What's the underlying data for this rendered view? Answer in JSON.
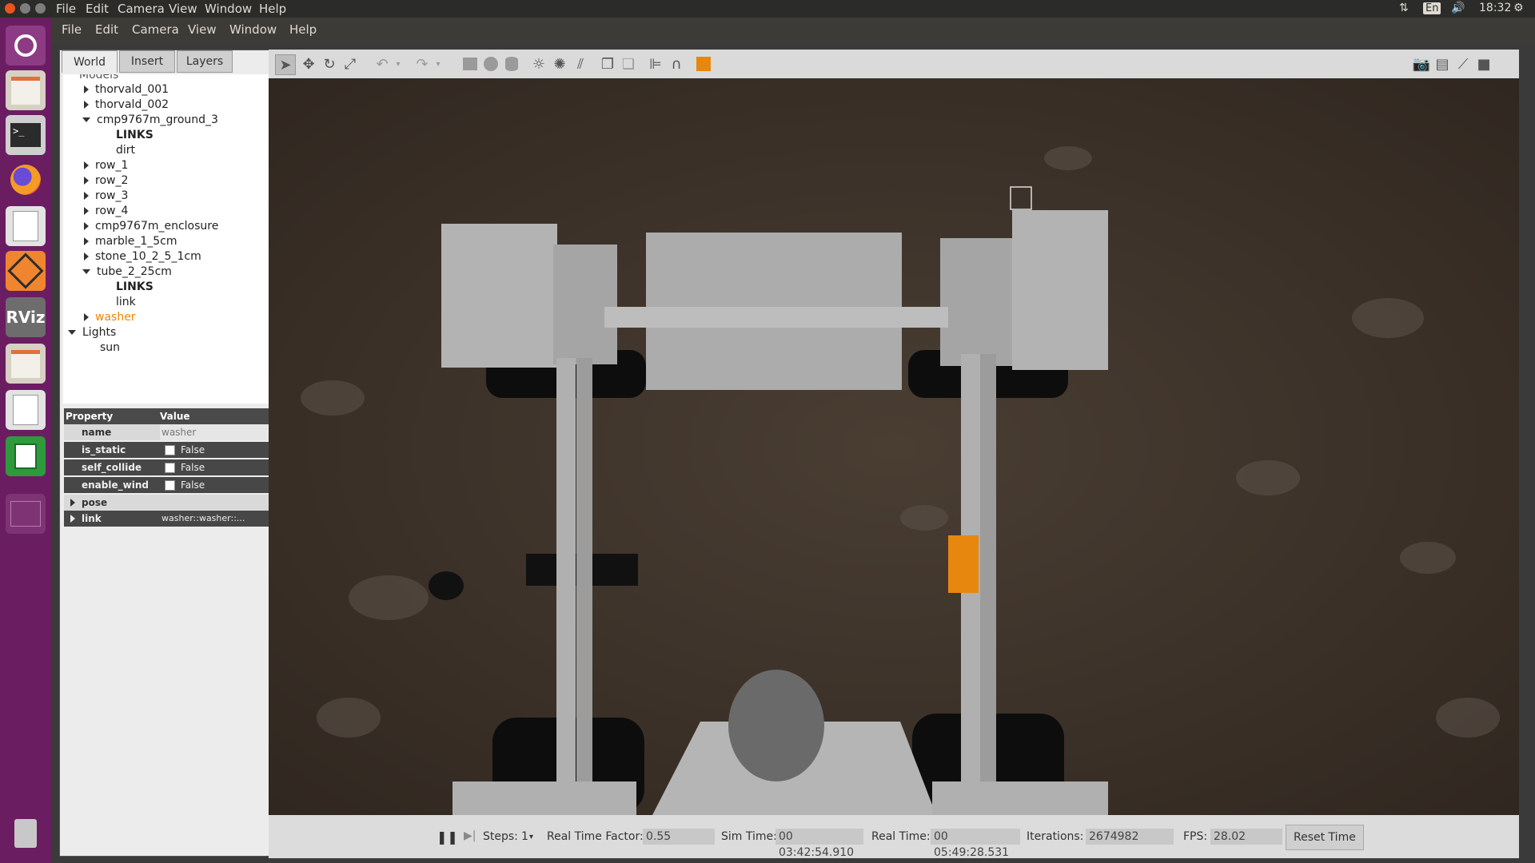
{
  "system_bar": {
    "menus": [
      "File",
      "Edit",
      "Camera",
      "View",
      "Window",
      "Help"
    ],
    "clock": "18:32",
    "keyboard": "En",
    "icons": [
      "network-icon",
      "keyboard-icon",
      "volume-icon",
      "settings-gear-icon"
    ]
  },
  "launcher": {
    "items": [
      {
        "name": "ubuntu-dash-icon"
      },
      {
        "name": "file-manager-icon"
      },
      {
        "name": "terminal-icon"
      },
      {
        "name": "firefox-icon"
      },
      {
        "name": "text-editor-icon"
      },
      {
        "name": "gazebo-icon"
      },
      {
        "name": "rviz-icon",
        "label": "RViz"
      },
      {
        "name": "file-manager-icon-2"
      },
      {
        "name": "text-editor-icon-2"
      },
      {
        "name": "spreadsheet-icon"
      },
      {
        "name": "workspace-switcher-icon"
      },
      {
        "name": "trash-icon"
      }
    ]
  },
  "app_menu": [
    "File",
    "Edit",
    "Camera",
    "View",
    "Window",
    "Help"
  ],
  "left_panel": {
    "tabs": [
      "World",
      "Insert",
      "Layers"
    ],
    "active_tab": "World",
    "tree": {
      "cut_header": "Models",
      "items": [
        {
          "label": "thorvald_001",
          "expanded": false,
          "level": 1
        },
        {
          "label": "thorvald_002",
          "expanded": false,
          "level": 1
        },
        {
          "label": "cmp9767m_ground_3",
          "expanded": true,
          "level": 1
        },
        {
          "label": "LINKS",
          "level": 2,
          "bold": true
        },
        {
          "label": "dirt",
          "level": 2
        },
        {
          "label": "row_1",
          "expanded": false,
          "level": 1
        },
        {
          "label": "row_2",
          "expanded": false,
          "level": 1
        },
        {
          "label": "row_3",
          "expanded": false,
          "level": 1
        },
        {
          "label": "row_4",
          "expanded": false,
          "level": 1
        },
        {
          "label": "cmp9767m_enclosure",
          "expanded": false,
          "level": 1
        },
        {
          "label": "marble_1_5cm",
          "expanded": false,
          "level": 1
        },
        {
          "label": "stone_10_2_5_1cm",
          "expanded": false,
          "level": 1
        },
        {
          "label": "tube_2_25cm",
          "expanded": true,
          "level": 1
        },
        {
          "label": "LINKS",
          "level": 2,
          "bold": true
        },
        {
          "label": "link",
          "level": 2
        },
        {
          "label": "washer",
          "expanded": false,
          "level": 1,
          "selected": true
        },
        {
          "label": "Lights",
          "expanded": true,
          "level": 0
        },
        {
          "label": "sun",
          "level": 1
        }
      ],
      "selected_color": "#e8870e"
    },
    "properties": {
      "header_property": "Property",
      "header_value": "Value",
      "rows": [
        {
          "name": "name",
          "value": "washer",
          "checkbox": false
        },
        {
          "name": "is_static",
          "value": "False",
          "checkbox": true
        },
        {
          "name": "self_collide",
          "value": "False",
          "checkbox": true
        },
        {
          "name": "enable_wind",
          "value": "False",
          "checkbox": true
        },
        {
          "name": "pose",
          "value": "",
          "expandable": true
        },
        {
          "name": "link",
          "value": "washer::washer::...",
          "expandable": true
        }
      ]
    }
  },
  "toolbar": {
    "tools": [
      "select-arrow-icon",
      "translate-icon",
      "rotate-icon",
      "scale-icon",
      "undo-icon",
      "undo-dropdown-icon",
      "redo-icon",
      "redo-dropdown-icon",
      "box-shape-icon",
      "sphere-shape-icon",
      "cylinder-shape-icon",
      "point-light-icon",
      "spot-light-icon",
      "directional-light-icon",
      "copy-icon",
      "paste-icon",
      "align-icon",
      "snap-icon",
      "view-angle-icon"
    ],
    "right_tools": [
      "screenshot-icon",
      "log-icon",
      "plot-icon",
      "video-record-icon"
    ]
  },
  "bottom_bar": {
    "steps_label": "Steps:",
    "steps_value": "1",
    "rtf_label": "Real Time Factor:",
    "rtf_value": "0.55",
    "sim_label": "Sim Time:",
    "sim_value": "00 03:42:54.910",
    "real_label": "Real Time:",
    "real_value": "00 05:49:28.531",
    "iter_label": "Iterations:",
    "iter_value": "2674982",
    "fps_label": "FPS:",
    "fps_value": "28.02",
    "reset_label": "Reset Time"
  },
  "colors": {
    "launcher_bg": "#6b1d62",
    "ground": "#3b3128",
    "robot_body": "#a9a9a9",
    "washer": "#e8870e"
  }
}
